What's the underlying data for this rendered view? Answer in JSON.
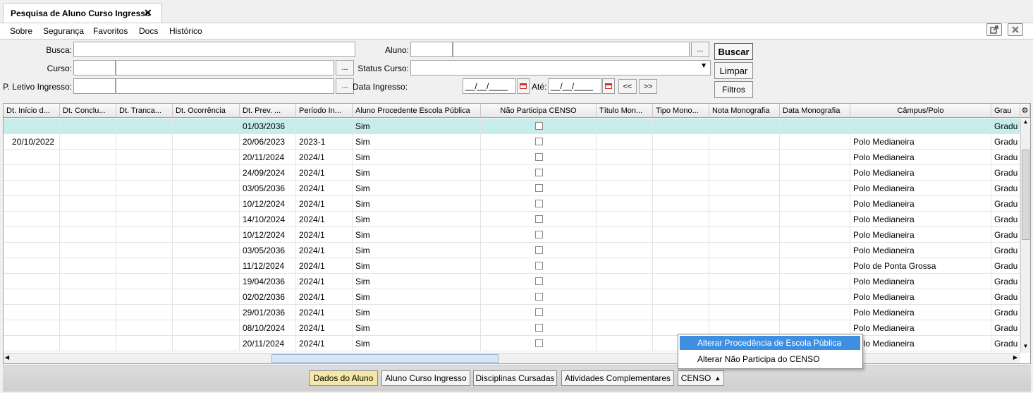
{
  "tab": {
    "title": "Pesquisa de Aluno Curso Ingresso",
    "close": "✕"
  },
  "menu": [
    "Sobre",
    "Segurança",
    "Favoritos",
    "Docs",
    "Histórico"
  ],
  "form": {
    "busca_label": "Busca:",
    "curso_label": "Curso:",
    "periodo_label": "P. Letivo Ingresso:",
    "aluno_label": "Aluno:",
    "status_label": "Status Curso:",
    "data_label": "Data Ingresso:",
    "ate_label": "Até:",
    "date_placeholder": "__/__/____",
    "ellipsis": "...",
    "prev": "<<",
    "next": ">>"
  },
  "buttons": {
    "buscar": "Buscar",
    "limpar": "Limpar",
    "filtros": "Filtros"
  },
  "columns": [
    "Dt. Início d...",
    "Dt. Conclu...",
    "Dt. Tranca...",
    "Dt. Ocorrência",
    "Dt. Prev. ...",
    "Período In...",
    "Aluno Procedente Escola Pública",
    "Não Participa CENSO",
    "Título Mon...",
    "Tipo Mono...",
    "Nota Monografia",
    "Data Monografia",
    "Câmpus/Polo",
    "Grau"
  ],
  "rows": [
    {
      "inicio": "",
      "prev": "01/03/2036",
      "periodo": "",
      "procedente": "Sim",
      "campus": "",
      "grau": "Gradu"
    },
    {
      "inicio": "20/10/2022",
      "prev": "20/06/2023",
      "periodo": "2023-1",
      "procedente": "Sim",
      "campus": "Polo Medianeira",
      "grau": "Gradu"
    },
    {
      "inicio": "",
      "prev": "20/11/2024",
      "periodo": "2024/1",
      "procedente": "Sim",
      "campus": "Polo Medianeira",
      "grau": "Gradu"
    },
    {
      "inicio": "",
      "prev": "24/09/2024",
      "periodo": "2024/1",
      "procedente": "Sim",
      "campus": "Polo Medianeira",
      "grau": "Gradu"
    },
    {
      "inicio": "",
      "prev": "03/05/2036",
      "periodo": "2024/1",
      "procedente": "Sim",
      "campus": "Polo Medianeira",
      "grau": "Gradu"
    },
    {
      "inicio": "",
      "prev": "10/12/2024",
      "periodo": "2024/1",
      "procedente": "Sim",
      "campus": "Polo Medianeira",
      "grau": "Gradu"
    },
    {
      "inicio": "",
      "prev": "14/10/2024",
      "periodo": "2024/1",
      "procedente": "Sim",
      "campus": "Polo Medianeira",
      "grau": "Gradu"
    },
    {
      "inicio": "",
      "prev": "10/12/2024",
      "periodo": "2024/1",
      "procedente": "Sim",
      "campus": "Polo Medianeira",
      "grau": "Gradu"
    },
    {
      "inicio": "",
      "prev": "03/05/2036",
      "periodo": "2024/1",
      "procedente": "Sim",
      "campus": "Polo Medianeira",
      "grau": "Gradu"
    },
    {
      "inicio": "",
      "prev": "11/12/2024",
      "periodo": "2024/1",
      "procedente": "Sim",
      "campus": "Polo de Ponta Grossa",
      "grau": "Gradu"
    },
    {
      "inicio": "",
      "prev": "19/04/2036",
      "periodo": "2024/1",
      "procedente": "Sim",
      "campus": "Polo Medianeira",
      "grau": "Gradu"
    },
    {
      "inicio": "",
      "prev": "02/02/2036",
      "periodo": "2024/1",
      "procedente": "Sim",
      "campus": "Polo Medianeira",
      "grau": "Gradu"
    },
    {
      "inicio": "",
      "prev": "29/01/2036",
      "periodo": "2024/1",
      "procedente": "Sim",
      "campus": "Polo Medianeira",
      "grau": "Gradu"
    },
    {
      "inicio": "",
      "prev": "08/10/2024",
      "periodo": "2024/1",
      "procedente": "Sim",
      "campus": "Polo Medianeira",
      "grau": "Gradu"
    },
    {
      "inicio": "",
      "prev": "20/11/2024",
      "periodo": "2024/1",
      "procedente": "Sim",
      "campus": "Polo Medianeira",
      "grau": "Gradu"
    }
  ],
  "footer": {
    "dados": "Dados do Aluno",
    "curso": "Aluno Curso Ingresso",
    "disciplinas": "Disciplinas Cursadas",
    "atividades": "Atividades Complementares",
    "censo": "CENSO"
  },
  "popup": {
    "item1": "Alterar Procedência de Escola Pública",
    "item2": "Alterar Não Participa do CENSO"
  },
  "colors": {
    "selected_row": "#c7ecec",
    "popup_highlight": "#3f8fe0",
    "dados_button": "#f5e7a8"
  }
}
